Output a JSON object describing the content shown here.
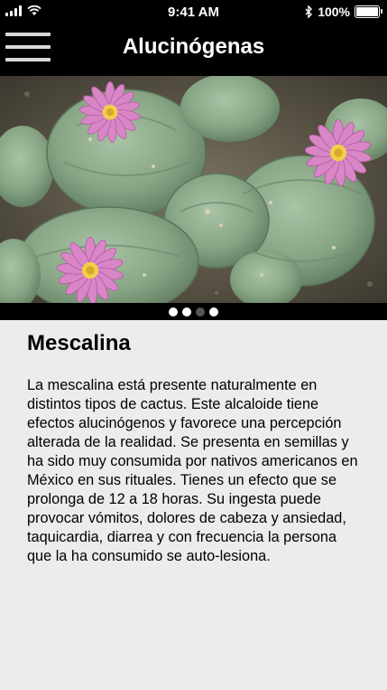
{
  "status_bar": {
    "time": "9:41 AM",
    "battery_text": "100%",
    "icons": [
      "signal-icon",
      "wifi-icon",
      "bluetooth-icon",
      "battery-icon"
    ]
  },
  "header": {
    "title": "Alucinógenas",
    "menu_icon": "hamburger-menu-icon"
  },
  "carousel": {
    "image": "peyote-cactus-photo",
    "page_count": 4,
    "active_page": 2
  },
  "article": {
    "title": "Mescalina",
    "body": "La mescalina está presente naturalmente en distintos tipos de cactus. Este alcaloide tiene efectos alucinógenos y favorece una percepción alterada de la realidad. Se presenta en semillas y ha sido muy consumida por nativos americanos en México en sus rituales. Tienes un efecto que se prolonga de 12 a 18 horas. Su ingesta puede provocar vómitos, dolores de cabeza y ansiedad, taquicardia, diarrea y con frecuencia la persona que la ha consumido se auto-lesiona."
  },
  "colors": {
    "bar_background": "#000000",
    "content_background": "#ececec",
    "cactus_green": "#8fb08f",
    "flower_pink": "#d981c8"
  }
}
